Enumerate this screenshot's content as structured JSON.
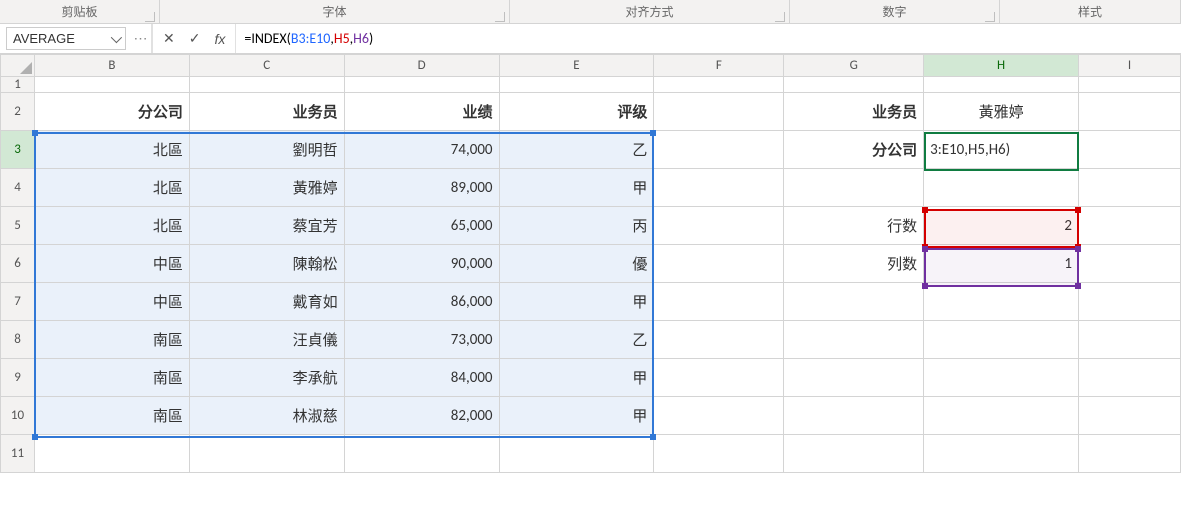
{
  "ribbon": {
    "groups": [
      "剪贴板",
      "字体",
      "对齐方式",
      "数字",
      "样式"
    ]
  },
  "formulaBar": {
    "nameBox": "AVERAGE",
    "fx": "fx",
    "formulaPrefix": "=INDEX(",
    "arg1": "B3:E10",
    "arg2": "H5",
    "arg3": "H6",
    "formulaSuffix": ")"
  },
  "columns": [
    "B",
    "C",
    "D",
    "E",
    "F",
    "G",
    "H",
    "I"
  ],
  "rows": [
    "1",
    "2",
    "3",
    "4",
    "5",
    "6",
    "7",
    "8",
    "9",
    "10",
    "11"
  ],
  "headers": {
    "B": "分公司",
    "C": "业务员",
    "D": "业绩",
    "E": "评级",
    "G2": "业务员",
    "G3": "分公司",
    "G5": "行数",
    "G6": "列数"
  },
  "H2": "黃雅婷",
  "H3": "3:E10,H5,H6)",
  "H5": "2",
  "H6": "1",
  "table": [
    {
      "b": "北區",
      "c": "劉明哲",
      "d": "74,000",
      "e": "乙"
    },
    {
      "b": "北區",
      "c": "黃雅婷",
      "d": "89,000",
      "e": "甲"
    },
    {
      "b": "北區",
      "c": "蔡宜芳",
      "d": "65,000",
      "e": "丙"
    },
    {
      "b": "中區",
      "c": "陳翰松",
      "d": "90,000",
      "e": "優"
    },
    {
      "b": "中區",
      "c": "戴育如",
      "d": "86,000",
      "e": "甲"
    },
    {
      "b": "南區",
      "c": "汪貞儀",
      "d": "73,000",
      "e": "乙"
    },
    {
      "b": "南區",
      "c": "李承航",
      "d": "84,000",
      "e": "甲"
    },
    {
      "b": "南區",
      "c": "林淑慈",
      "d": "82,000",
      "e": "甲"
    }
  ],
  "chart_data": null
}
